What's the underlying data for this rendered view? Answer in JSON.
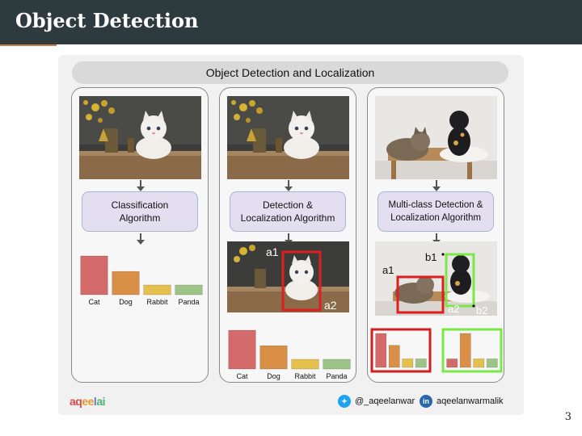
{
  "header": {
    "title": "Object Detection"
  },
  "page_number": "3",
  "figure": {
    "banner": "Object Detection and Localization",
    "panels": [
      {
        "algorithm_lines": [
          "Classification",
          "Algorithm"
        ]
      },
      {
        "algorithm_lines": [
          "Detection &",
          "Localization Algorithm"
        ]
      },
      {
        "algorithm_lines": [
          "Multi-class Detection &",
          "Localization Algorithm"
        ]
      }
    ],
    "box_labels": {
      "a1": "a1",
      "a2": "a2",
      "b1": "b1",
      "b2": "b2"
    },
    "footer": {
      "logo": [
        "aq",
        "ee",
        "l",
        "ai"
      ],
      "twitter": "@_aqeelanwar",
      "linkedin": "aqeelanwarmalik",
      "twitter_icon": "twitter-bird",
      "linkedin_icon": "in"
    }
  },
  "chart_data": [
    {
      "type": "bar",
      "categories": [
        "Cat",
        "Dog",
        "Rabbit",
        "Panda"
      ],
      "values": [
        1.0,
        0.6,
        0.25,
        0.25
      ],
      "colors": [
        "#d46a6a",
        "#d98f45",
        "#e6c04c",
        "#9dc487"
      ],
      "ylim": [
        0,
        1
      ]
    },
    {
      "type": "bar",
      "categories": [
        "Cat",
        "Dog",
        "Rabbit",
        "Panda"
      ],
      "values": [
        1.0,
        0.6,
        0.25,
        0.25
      ],
      "colors": [
        "#d46a6a",
        "#d98f45",
        "#e6c04c",
        "#9dc487"
      ],
      "ylim": [
        0,
        1
      ]
    },
    {
      "type": "bar",
      "categories": [],
      "values": [
        1.0,
        0.65,
        0.25,
        0.25
      ],
      "colors": [
        "#d46a6a",
        "#d98f45",
        "#e6c04c",
        "#9dc487"
      ],
      "ylim": [
        0,
        1
      ],
      "frame_color": "#cc2222"
    },
    {
      "type": "bar",
      "categories": [],
      "values": [
        0.25,
        1.0,
        0.25,
        0.25
      ],
      "colors": [
        "#d46a6a",
        "#d98f45",
        "#e6c04c",
        "#9dc487"
      ],
      "ylim": [
        0,
        1
      ],
      "frame_color": "#7be84a"
    }
  ]
}
